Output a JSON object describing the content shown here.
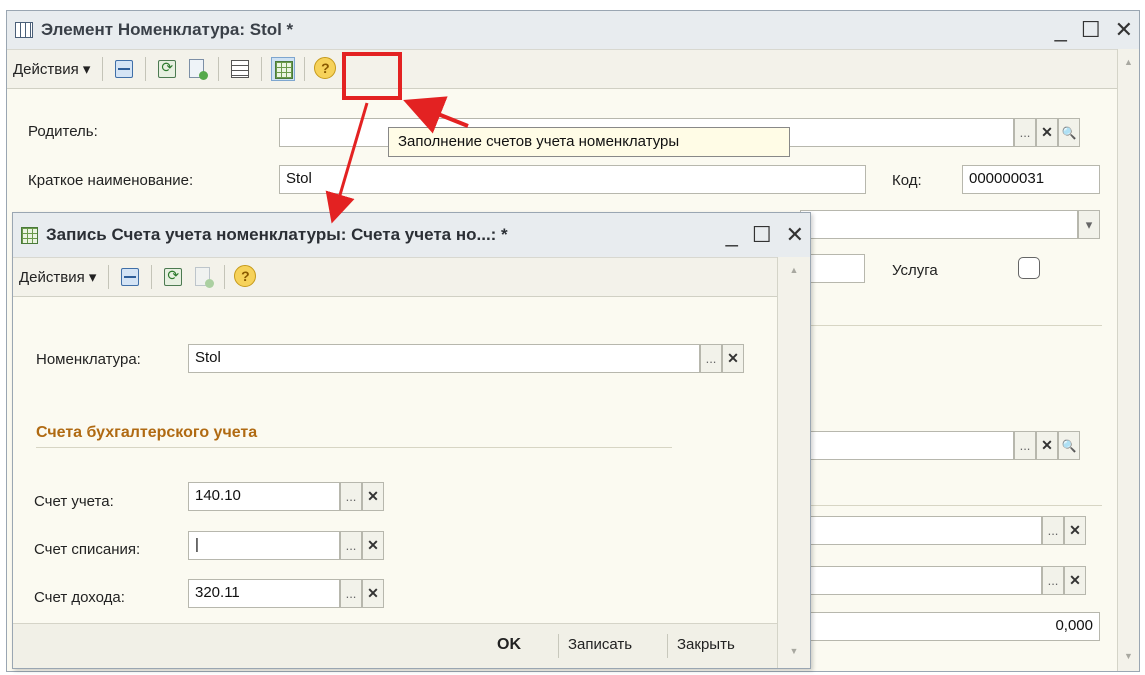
{
  "main_window": {
    "title": "Элемент Номенклатура: Stol *",
    "window_controls": [
      "_",
      "☐",
      "✕"
    ],
    "toolbar": {
      "actions_label": "Действия ▾"
    },
    "fields": {
      "parent_label": "Родитель:",
      "parent_value": "",
      "short_name_label": "Краткое наименование:",
      "short_name_value": "Stol",
      "code_label": "Код:",
      "code_value": "000000031",
      "service_label": "Услуга",
      "amount_value": "0,000"
    },
    "tooltip": "Заполнение счетов учета номенклатуры"
  },
  "dialog": {
    "title": "Запись Счета учета номенклатуры: Счета учета но...: *",
    "window_controls": [
      "_",
      "☐",
      "✕"
    ],
    "toolbar": {
      "actions_label": "Действия ▾"
    },
    "nomenclature_label": "Номенклатура:",
    "nomenclature_value": "Stol",
    "section_title": "Счета бухгалтерского учета",
    "account_label": "Счет учета:",
    "account_value": "140.10",
    "writeoff_label": "Счет списания:",
    "writeoff_value": "|",
    "income_label": "Счет дохода:",
    "income_value": "320.11",
    "footer": {
      "ok": "OK",
      "save": "Записать",
      "close": "Закрыть"
    }
  },
  "field_buttons": {
    "choose": "...",
    "clear": "✕",
    "open": "🔍"
  },
  "colors": {
    "highlight_red": "#e32222",
    "section_title": "#b06a12"
  }
}
